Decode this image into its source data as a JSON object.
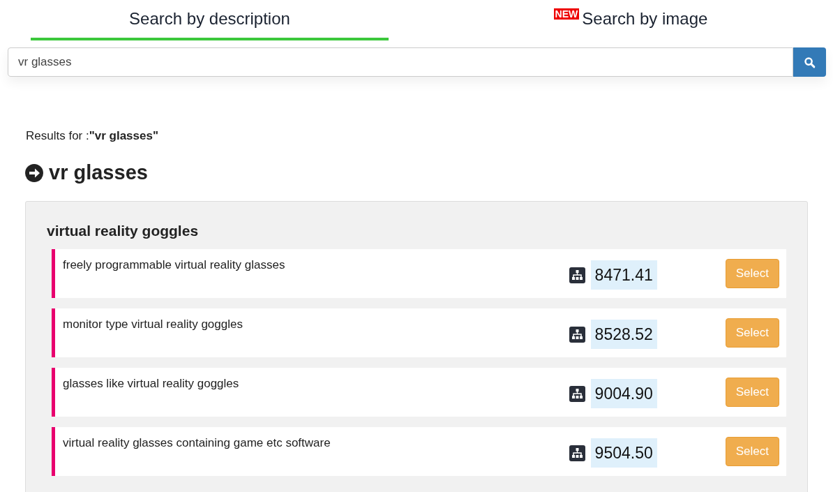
{
  "tabs": [
    {
      "label": "Search by description",
      "selected": true
    },
    {
      "label": "Search by image",
      "selected": false,
      "badge": "NEW"
    }
  ],
  "search": {
    "value": "vr glasses"
  },
  "results_for": "Results for :**\"vr glasses\"**",
  "heading": "vr glasses",
  "group": {
    "title": "virtual reality goggles",
    "items": [
      {
        "text": "freely programmable virtual reality glasses",
        "score": "8471.41",
        "button": "Select"
      },
      {
        "text": "monitor type virtual reality goggles",
        "score": "8528.52",
        "button": "Select"
      },
      {
        "text": "glasses like virtual reality goggles",
        "score": "9004.90",
        "button": "Select"
      },
      {
        "text": "virtual reality glasses containing game etc software",
        "score": "9504.50",
        "button": "Select"
      }
    ]
  }
}
